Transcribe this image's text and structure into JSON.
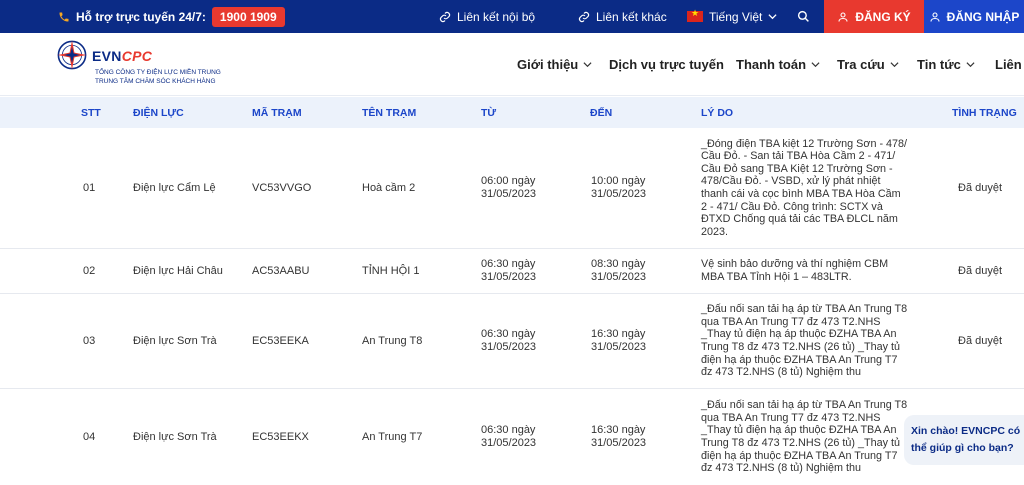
{
  "topbar": {
    "hotline_label": "Hỗ trợ trực tuyến 24/7:",
    "hotline_number": "1900 1909",
    "link_internal": "Liên kết nội bộ",
    "link_other": "Liên kết khác",
    "language": "Tiếng Việt",
    "register": "ĐĂNG KÝ",
    "login": "ĐĂNG NHẬP"
  },
  "brand": {
    "name_main": "EVN",
    "name_accent": "CPC",
    "subtitle_1": "TỔNG CÔNG TY ĐIỆN LỰC MIỀN TRUNG",
    "subtitle_2": "TRUNG TÂM CHĂM SÓC KHÁCH HÀNG"
  },
  "nav": {
    "intro": "Giới thiệu",
    "online": "Dịch vụ trực tuyến",
    "payment": "Thanh toán",
    "lookup": "Tra cứu",
    "news": "Tin tức",
    "contact": "Liên h"
  },
  "table": {
    "headers": [
      "STT",
      "ĐIỆN LỰC",
      "MÃ TRẠM",
      "TÊN TRẠM",
      "TỪ",
      "ĐẾN",
      "LÝ DO",
      "TÌNH TRẠNG"
    ],
    "rows": [
      {
        "stt": "01",
        "dien_luc": "Điện lực Cẩm Lệ",
        "ma_tram": "VC53VVGO",
        "ten_tram": "Hoà cầm 2",
        "tu_1": "06:00 ngày",
        "tu_2": "31/05/2023",
        "den_1": "10:00 ngày",
        "den_2": "31/05/2023",
        "ly_do": [
          "_Đóng điện TBA kiệt 12 Trường Sơn - 478/",
          "Cầu Đỏ. - San tải TBA Hòa Cầm 2 - 471/",
          "Cầu Đỏ sang TBA Kiệt 12 Trường Sơn -",
          "478/Cầu Đỏ. - VSBD, xử lý phát nhiệt",
          "thanh cái và cọc bình MBA TBA Hòa Cầm",
          "2 - 471/ Cầu Đỏ. Công trình: SCTX và",
          "ĐTXD Chống quá tải các TBA ĐLCL năm",
          "2023."
        ],
        "tinh_trang": "Đã duyệt"
      },
      {
        "stt": "02",
        "dien_luc": "Điện lực Hải Châu",
        "ma_tram": "AC53AABU",
        "ten_tram": "TỈNH HỘI 1",
        "tu_1": "06:30 ngày",
        "tu_2": "31/05/2023",
        "den_1": "08:30 ngày",
        "den_2": "31/05/2023",
        "ly_do": [
          "Vệ sinh bảo dưỡng và thí nghiệm CBM",
          "MBA TBA Tỉnh Hội 1 – 483LTR."
        ],
        "tinh_trang": "Đã duyệt"
      },
      {
        "stt": "03",
        "dien_luc": "Điện lực Sơn Trà",
        "ma_tram": "EC53EEKA",
        "ten_tram": "An Trung T8",
        "tu_1": "06:30 ngày",
        "tu_2": "31/05/2023",
        "den_1": "16:30 ngày",
        "den_2": "31/05/2023",
        "ly_do": [
          "_Đấu nối san tải hạ áp từ TBA An Trung T8",
          "qua TBA An Trung T7 đz 473 T2.NHS",
          "_Thay tủ điện hạ áp thuộc ĐZHA TBA An",
          "Trung T8 đz 473 T2.NHS (26 tủ) _Thay tủ",
          "điện hạ áp thuộc ĐZHA TBA An Trung T7",
          "đz 473 T2.NHS (8 tủ) Nghiệm thu"
        ],
        "tinh_trang": "Đã duyệt"
      },
      {
        "stt": "04",
        "dien_luc": "Điện lực Sơn Trà",
        "ma_tram": "EC53EEKX",
        "ten_tram": "An Trung T7",
        "tu_1": "06:30 ngày",
        "tu_2": "31/05/2023",
        "den_1": "16:30 ngày",
        "den_2": "31/05/2023",
        "ly_do": [
          "_Đấu nối san tải hạ áp từ TBA An Trung T8",
          "qua TBA An Trung T7 đz 473 T2.NHS",
          "_Thay tủ điện hạ áp thuộc ĐZHA TBA An",
          "Trung T8 đz 473 T2.NHS (26 tủ) _Thay tủ",
          "điện hạ áp thuộc ĐZHA TBA An Trung T7",
          "đz 473 T2.NHS (8 tủ) Nghiệm thu"
        ],
        "tinh_trang": ""
      }
    ]
  },
  "chat": {
    "line1": "Xin chào! EVNCPC có",
    "line2": "thể giúp gì cho bạn?"
  },
  "colors": {
    "navy": "#0b2b86",
    "red": "#e8392f",
    "blue": "#1c46c9",
    "header_bg": "#ecf2fb"
  }
}
